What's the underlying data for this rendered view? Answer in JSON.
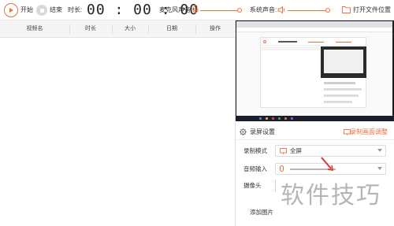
{
  "toolbar": {
    "start_label": "开始",
    "stop_label": "结束",
    "duration_label": "时长:",
    "timer": "00 : 00 : 00",
    "mic_label": "麦克风声音:",
    "system_label": "系统声音:",
    "open_folder_label": "打开文件位置"
  },
  "list": {
    "columns": [
      "视频名",
      "时长",
      "大小",
      "日期",
      "操作"
    ]
  },
  "settings": {
    "title": "录屏设置",
    "advanced_link": "录制画面调整",
    "rows": [
      {
        "label": "录制模式",
        "value": "全屏"
      },
      {
        "label": "音频输入",
        "value": ""
      },
      {
        "label": "摄像头",
        "value": ""
      },
      {
        "label": "添加图片",
        "value": ""
      }
    ]
  },
  "watermark": "软件技巧",
  "colors": {
    "accent": "#e8713a",
    "header_bg": "#f5f5f5",
    "preview_bg": "#1c1c1c"
  },
  "icons": [
    "play-icon",
    "stop-icon",
    "microphone-icon",
    "speaker-icon",
    "folder-icon",
    "gear-icon",
    "monitor-icon"
  ]
}
